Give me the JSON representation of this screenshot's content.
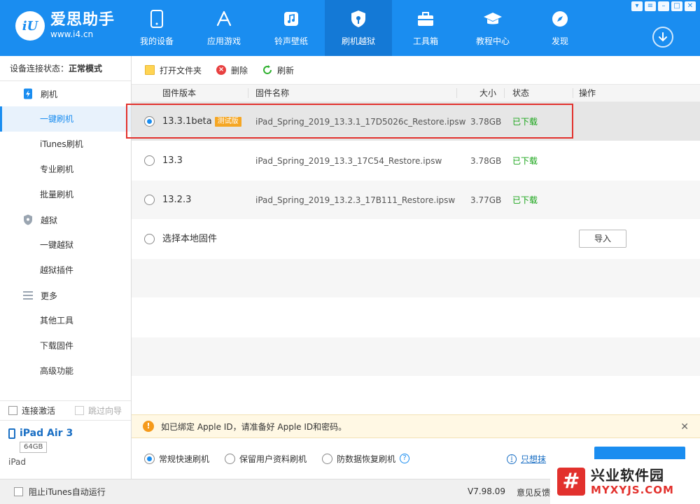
{
  "header": {
    "logo_name": "爱思助手",
    "logo_url": "www.i4.cn",
    "logo_mark": "iU",
    "nav": [
      {
        "label": "我的设备",
        "icon": "phone-icon"
      },
      {
        "label": "应用游戏",
        "icon": "app-store-icon"
      },
      {
        "label": "铃声壁纸",
        "icon": "music-icon"
      },
      {
        "label": "刷机越狱",
        "icon": "flash-icon",
        "active": true
      },
      {
        "label": "工具箱",
        "icon": "toolbox-icon"
      },
      {
        "label": "教程中心",
        "icon": "graduation-cap-icon"
      },
      {
        "label": "发现",
        "icon": "compass-icon"
      }
    ],
    "accent_color": "#1a8df0"
  },
  "sidebar": {
    "status_label": "设备连接状态：",
    "status_value": "正常模式",
    "groups": [
      {
        "label": "刷机",
        "icon": "flash-icon",
        "items": [
          "一键刷机",
          "iTunes刷机",
          "专业刷机",
          "批量刷机"
        ]
      },
      {
        "label": "越狱",
        "icon": "shield-icon",
        "items": [
          "一键越狱",
          "越狱插件"
        ]
      },
      {
        "label": "更多",
        "icon": "menu-icon",
        "items": [
          "其他工具",
          "下载固件",
          "高级功能"
        ]
      }
    ],
    "active_item": "一键刷机",
    "auto_activate": "连接激活",
    "skip_guide": "跳过向导",
    "device": {
      "name": "iPad Air 3",
      "capacity": "64GB",
      "type": "iPad"
    }
  },
  "toolbar": {
    "open_folder": "打开文件夹",
    "delete": "删除",
    "refresh": "刷新"
  },
  "table": {
    "headers": {
      "version": "固件版本",
      "name": "固件名称",
      "size": "大小",
      "status": "状态",
      "action": "操作"
    },
    "rows": [
      {
        "version": "13.3.1beta",
        "tag": "测试版",
        "name": "iPad_Spring_2019_13.3.1_17D5026c_Restore.ipsw",
        "size": "3.78GB",
        "status": "已下载",
        "selected": true
      },
      {
        "version": "13.3",
        "name": "iPad_Spring_2019_13.3_17C54_Restore.ipsw",
        "size": "3.78GB",
        "status": "已下载"
      },
      {
        "version": "13.2.3",
        "name": "iPad_Spring_2019_13.2.3_17B111_Restore.ipsw",
        "size": "3.77GB",
        "status": "已下载"
      }
    ],
    "local_label": "选择本地固件",
    "import_label": "导入"
  },
  "notice": {
    "text": "如已绑定 Apple ID，请准备好 Apple ID和密码。"
  },
  "modes": {
    "options": [
      "常规快速刷机",
      "保留用户资料刷机",
      "防数据恢复刷机"
    ],
    "selected": "常规快速刷机",
    "erase_link": "只想抹"
  },
  "statusbar": {
    "block_itunes": "阻止iTunes自动运行",
    "version": "V7.98.09",
    "feedback": "意见反馈"
  },
  "watermark": {
    "mark": "#",
    "title": "兴业软件园",
    "url": "MYXYJS.COM"
  }
}
